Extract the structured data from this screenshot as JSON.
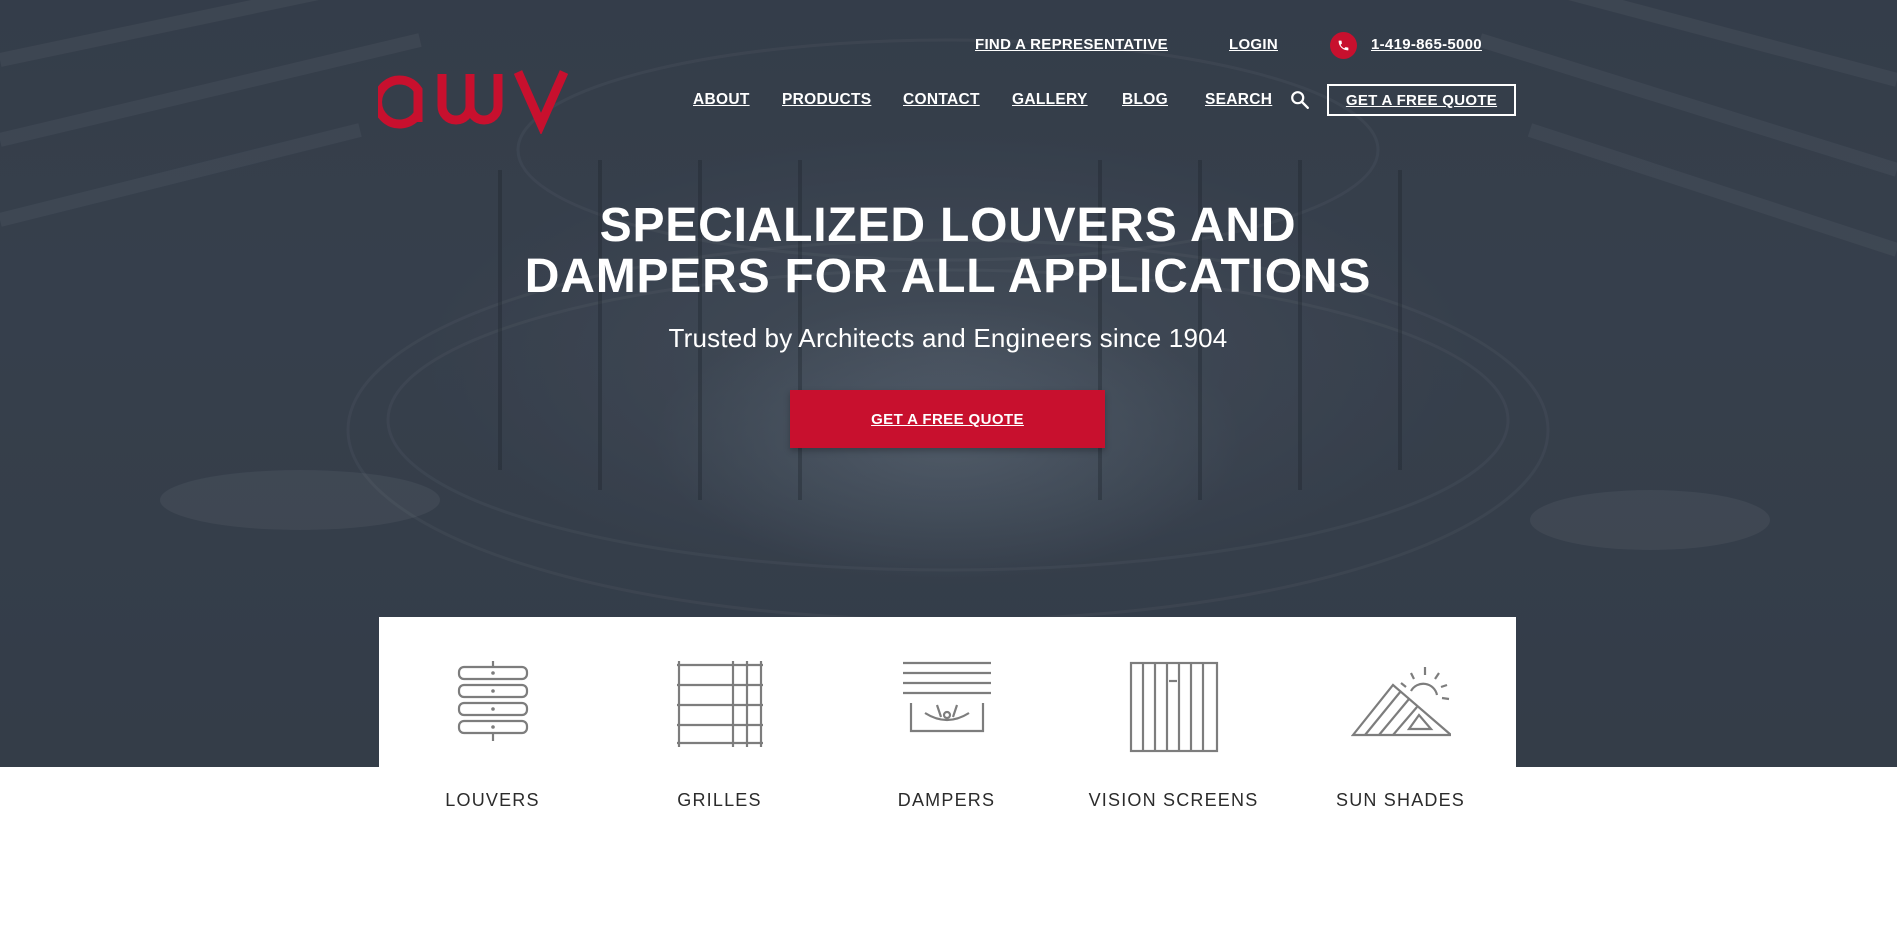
{
  "brand": {
    "logo_text": "awv",
    "accent_color": "#c8102e"
  },
  "topbar": {
    "find_rep": "FIND A REPRESENTATIVE",
    "login": "LOGIN",
    "phone_icon": "phone-icon",
    "phone": "1-419-865-5000"
  },
  "nav": {
    "items": [
      "ABOUT",
      "PRODUCTS",
      "CONTACT",
      "GALLERY",
      "BLOG",
      "SEARCH"
    ],
    "search_icon": "search-icon",
    "quote_button": "GET A FREE QUOTE"
  },
  "hero": {
    "title_line1": "SPECIALIZED LOUVERS AND",
    "title_line2": "DAMPERS FOR ALL APPLICATIONS",
    "subtitle": "Trusted by Architects and Engineers since 1904",
    "cta": "GET A FREE QUOTE"
  },
  "products": [
    {
      "label": "LOUVERS",
      "icon": "louvers-icon"
    },
    {
      "label": "GRILLES",
      "icon": "grilles-icon"
    },
    {
      "label": "DAMPERS",
      "icon": "dampers-icon"
    },
    {
      "label": "VISION SCREENS",
      "icon": "vision-screens-icon"
    },
    {
      "label": "SUN SHADES",
      "icon": "sun-shades-icon"
    }
  ]
}
